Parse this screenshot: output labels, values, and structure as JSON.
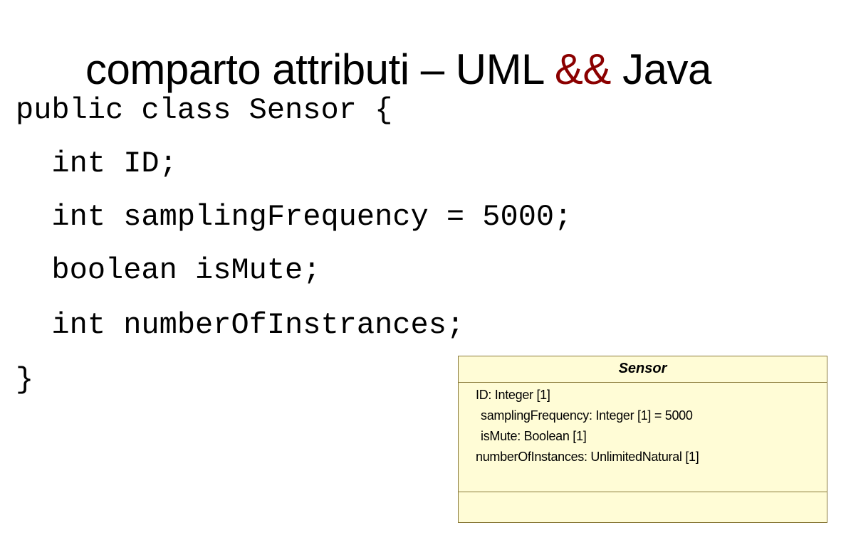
{
  "title": {
    "prefix": "comparto attributi – UML ",
    "accent": "&&",
    "suffix": " Java",
    "accent_color": "#8b0000"
  },
  "code": {
    "lines": [
      "public class Sensor {",
      "  int ID;",
      "  int samplingFrequency = 5000;",
      "  boolean isMute;",
      "  int numberOfInstrances;",
      "}"
    ]
  },
  "uml_class": {
    "name": "Sensor",
    "attributes": [
      "ID: Integer [1]",
      "samplingFrequency: Integer [1] = 5000",
      "isMute: Boolean [1]",
      "numberOfInstances: UnlimitedNatural [1]"
    ],
    "fill_color": "#fffcd6",
    "border_color": "#8a7a3a"
  }
}
